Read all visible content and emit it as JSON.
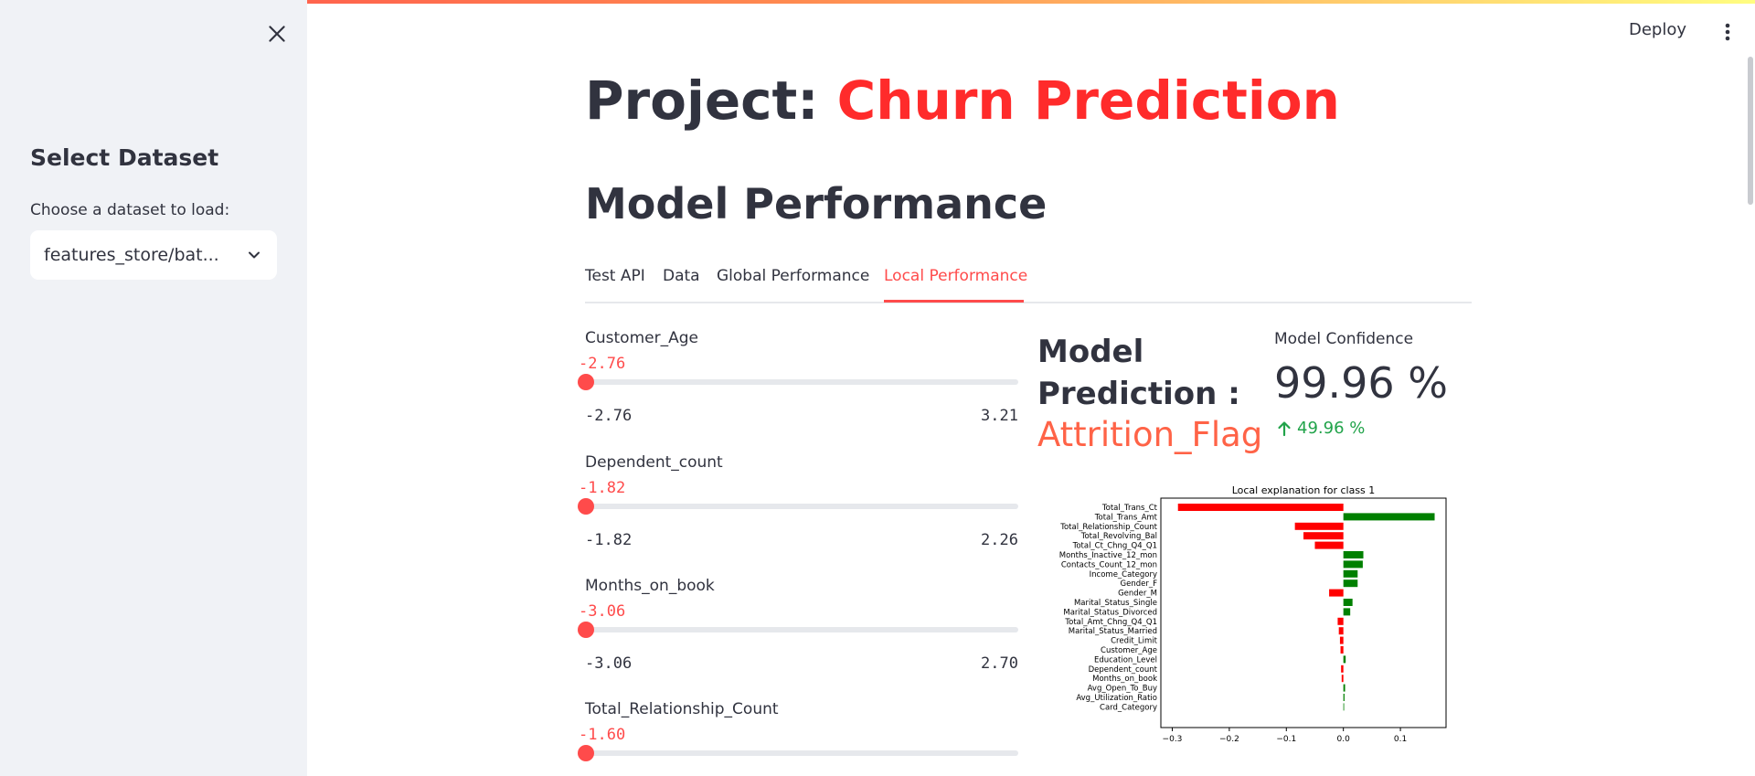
{
  "sidebar": {
    "heading": "Select Dataset",
    "label": "Choose a dataset to load:",
    "select_value": "features_store/bat..."
  },
  "header": {
    "deploy_label": "Deploy"
  },
  "main": {
    "title_prefix": "Project: ",
    "title_accent": "Churn Prediction",
    "subtitle": "Model Performance",
    "tabs": [
      {
        "label": "Test API"
      },
      {
        "label": "Data"
      },
      {
        "label": "Global Performance"
      },
      {
        "label": "Local Performance",
        "active": true
      }
    ],
    "sliders": [
      {
        "label": "Customer_Age",
        "value": "-2.76",
        "min": "-2.76",
        "max": "3.21"
      },
      {
        "label": "Dependent_count",
        "value": "-1.82",
        "min": "-1.82",
        "max": "2.26"
      },
      {
        "label": "Months_on_book",
        "value": "-3.06",
        "min": "-3.06",
        "max": "2.70"
      },
      {
        "label": "Total_Relationship_Count",
        "value": "-1.60"
      }
    ],
    "prediction": {
      "label_line1": "Model",
      "label_line2": "Prediction :",
      "value": "Attrition_Flag"
    },
    "metric": {
      "label": "Model Confidence",
      "value": "99.96 %",
      "delta": "49.96 %"
    }
  },
  "colors": {
    "accent": "#ff4b4b",
    "positive": "#008000",
    "negative": "#ff0000",
    "delta": "#21a34a"
  },
  "chart_data": {
    "type": "bar",
    "orientation": "horizontal",
    "title": "Local explanation for class 1",
    "categories": [
      "Total_Trans_Ct",
      "Total_Trans_Amt",
      "Total_Relationship_Count",
      "Total_Revolving_Bal",
      "Total_Ct_Chng_Q4_Q1",
      "Months_Inactive_12_mon",
      "Contacts_Count_12_mon",
      "Income_Category",
      "Gender_F",
      "Gender_M",
      "Marital_Status_Single",
      "Marital_Status_Divorced",
      "Total_Amt_Chng_Q4_Q1",
      "Marital_Status_Married",
      "Credit_Limit",
      "Customer_Age",
      "Education_Level",
      "Dependent_count",
      "Months_on_book",
      "Avg_Open_To_Buy",
      "Avg_Utilization_Ratio",
      "Card_Category"
    ],
    "values": [
      -0.29,
      0.16,
      -0.085,
      -0.07,
      -0.05,
      0.035,
      0.034,
      0.025,
      0.025,
      -0.025,
      0.016,
      0.012,
      -0.01,
      -0.008,
      -0.006,
      -0.005,
      0.004,
      -0.004,
      -0.003,
      0.003,
      0.002,
      0.001
    ],
    "xlim": [
      -0.32,
      0.18
    ],
    "xticks": [
      -0.3,
      -0.2,
      -0.1,
      0.0,
      0.1
    ],
    "xtick_labels": [
      "−0.3",
      "−0.2",
      "−0.1",
      "0.0",
      "0.1"
    ],
    "grid": false
  }
}
